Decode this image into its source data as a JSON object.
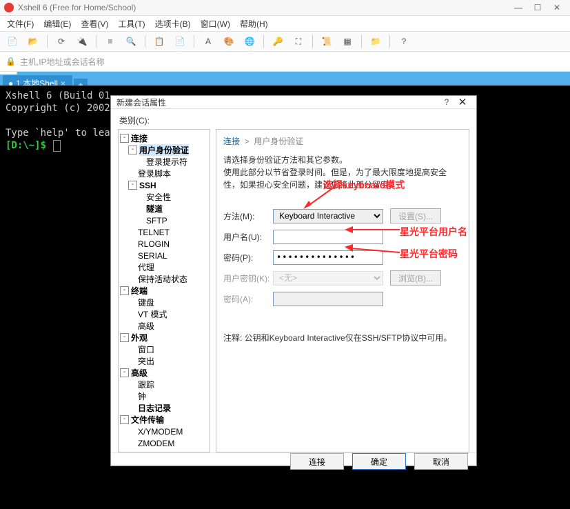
{
  "app": {
    "title": "Xshell 6 (Free for Home/School)"
  },
  "menubar": [
    "文件(F)",
    "编辑(E)",
    "查看(V)",
    "工具(T)",
    "选项卡(B)",
    "窗口(W)",
    "帮助(H)"
  ],
  "address_placeholder": "主机,IP地址或会话名称",
  "tab": {
    "label": "1 本地Shell"
  },
  "terminal": {
    "line1": "Xshell 6 (Build 01",
    "line2": "Copyright (c) 2002",
    "line3": "Type `help' to lea",
    "prompt": "[D:\\~]$ "
  },
  "dialog": {
    "title": "新建会话属性",
    "category_label": "类别(C):",
    "tree": [
      {
        "d": 0,
        "exp": "-",
        "bold": true,
        "label": "连接"
      },
      {
        "d": 1,
        "exp": "-",
        "bold": true,
        "label": "用户身份验证",
        "sel": true
      },
      {
        "d": 2,
        "label": "登录提示符"
      },
      {
        "d": 1,
        "label": "登录脚本"
      },
      {
        "d": 1,
        "exp": "-",
        "bold": true,
        "label": "SSH"
      },
      {
        "d": 2,
        "label": "安全性"
      },
      {
        "d": 2,
        "bold": true,
        "label": "隧道"
      },
      {
        "d": 2,
        "label": "SFTP"
      },
      {
        "d": 1,
        "label": "TELNET"
      },
      {
        "d": 1,
        "label": "RLOGIN"
      },
      {
        "d": 1,
        "label": "SERIAL"
      },
      {
        "d": 1,
        "label": "代理"
      },
      {
        "d": 1,
        "label": "保持活动状态"
      },
      {
        "d": 0,
        "exp": "-",
        "bold": true,
        "label": "终端"
      },
      {
        "d": 1,
        "label": "键盘"
      },
      {
        "d": 1,
        "label": "VT 模式"
      },
      {
        "d": 1,
        "label": "高级"
      },
      {
        "d": 0,
        "exp": "-",
        "bold": true,
        "label": "外观"
      },
      {
        "d": 1,
        "label": "窗口"
      },
      {
        "d": 1,
        "label": "突出"
      },
      {
        "d": 0,
        "exp": "-",
        "bold": true,
        "label": "高级"
      },
      {
        "d": 1,
        "label": "跟踪"
      },
      {
        "d": 1,
        "label": "钟"
      },
      {
        "d": 1,
        "bold": true,
        "label": "日志记录"
      },
      {
        "d": 0,
        "exp": "-",
        "bold": true,
        "label": "文件传输"
      },
      {
        "d": 1,
        "label": "X/YMODEM"
      },
      {
        "d": 1,
        "label": "ZMODEM"
      }
    ],
    "breadcrumb_connect": "连接",
    "breadcrumb_auth": "用户身份验证",
    "desc1": "请选择身份验证方法和其它参数。",
    "desc2": "使用此部分以节省登录时间。但是，为了最大限度地提高安全性，如果担心安全问题，建议您将此部分留空。",
    "labels": {
      "method": "方法(M):",
      "user": "用户名(U):",
      "pass": "密码(P):",
      "userkey": "用户密钥(K):",
      "passphrase": "密码(A):"
    },
    "method_value": "Keyboard Interactive",
    "user_value": "",
    "pass_value": "••••••••••••••",
    "userkey_value": "<无>",
    "btn_setting": "设置(S)...",
    "btn_browse": "浏览(B)...",
    "note": "注释: 公钥和Keyboard Interactive仅在SSH/SFTP协议中可用。",
    "footer": {
      "connect": "连接",
      "ok": "确定",
      "cancel": "取消"
    }
  },
  "annotations": {
    "a1": "选择keyboard模式",
    "a2": "星光平台用户名",
    "a3": "星光平台密码"
  }
}
